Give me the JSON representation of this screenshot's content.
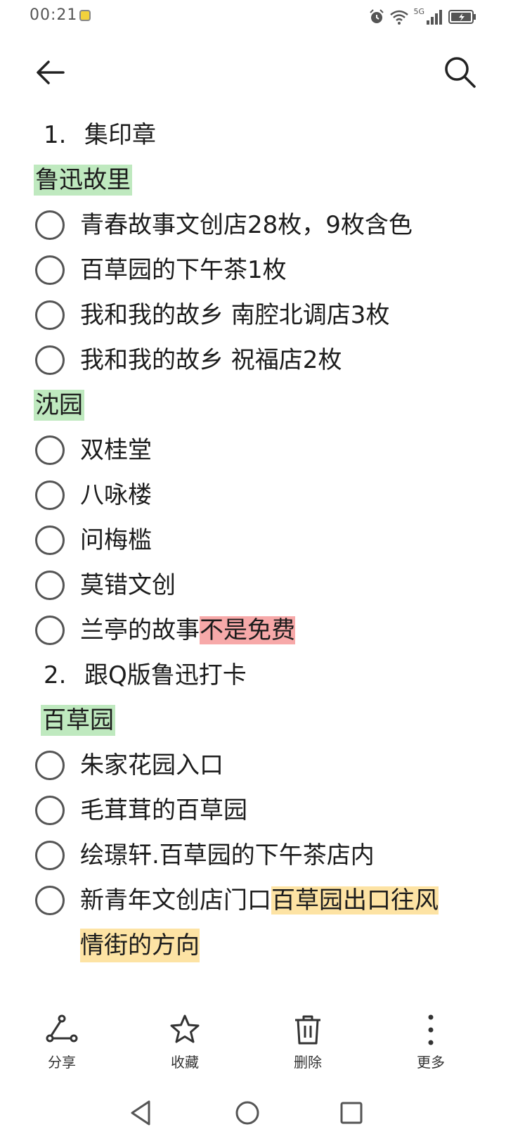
{
  "status": {
    "time": "00:21",
    "network": "5G",
    "icons": [
      "alarm-icon",
      "wifi-icon",
      "signal-icon",
      "battery-charging-icon"
    ]
  },
  "appbar": {
    "back_icon": "arrow-left-icon",
    "search_icon": "search-icon"
  },
  "note": {
    "section1": {
      "number": "1.",
      "title": "集印章"
    },
    "group1": {
      "label": "鲁迅故里",
      "items": [
        "青春故事文创店28枚，9枚含色",
        "百草园的下午茶1枚",
        "我和我的故乡 南腔北调店3枚",
        "我和我的故乡 祝福店2枚"
      ]
    },
    "group2": {
      "label": "沈园",
      "items": [
        "双桂堂",
        "八咏楼",
        "问梅槛",
        "莫错文创"
      ],
      "last_item_plain": "兰亭的故事",
      "last_item_highlight": "不是免费"
    },
    "section2": {
      "number": "2.",
      "title": "跟Q版鲁迅打卡"
    },
    "group3": {
      "label": "百草园",
      "items": [
        "朱家花园入口",
        "毛茸茸的百草园",
        "绘璟轩.百草园的下午茶店内"
      ],
      "last_item_plain": "新青年文创店门口",
      "last_item_highlight": "百草园出口往风",
      "last_item_continuation": "情街的方向"
    },
    "colors": {
      "green_highlight": "#bfe9bf",
      "red_highlight": "#f7a9a9",
      "yellow_highlight": "#fde3a4"
    }
  },
  "toolbar": {
    "share": {
      "label": "分享",
      "icon": "share-icon"
    },
    "favorite": {
      "label": "收藏",
      "icon": "star-icon"
    },
    "delete": {
      "label": "删除",
      "icon": "trash-icon"
    },
    "more": {
      "label": "更多",
      "icon": "more-vertical-icon"
    }
  },
  "system_nav": {
    "back_icon": "nav-back-triangle-icon",
    "home_icon": "nav-home-circle-icon",
    "recents_icon": "nav-recents-square-icon"
  }
}
